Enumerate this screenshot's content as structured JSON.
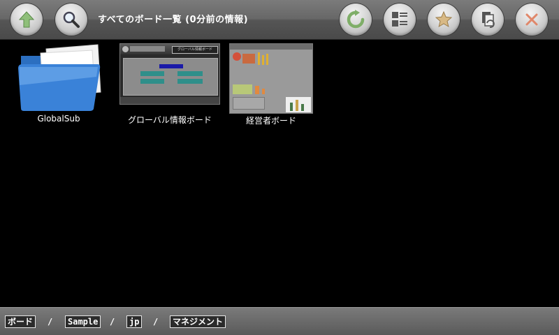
{
  "toolbar": {
    "title": "すべてのボード一覧 (0分前の情報)",
    "buttons": {
      "up": "up-arrow-icon",
      "search": "magnifier-icon",
      "refresh": "refresh-icon",
      "view": "view-mode-icon",
      "favorite": "star-icon",
      "copy": "copy-icon",
      "close": "close-icon"
    }
  },
  "items": [
    {
      "label": "GlobalSub",
      "kind": "folder"
    },
    {
      "label": "グローバル情報ボード",
      "kind": "board",
      "thumbnail_text": "グローバル情報ボード"
    },
    {
      "label": "経営者ボード",
      "kind": "board"
    }
  ],
  "breadcrumb": {
    "items": [
      "ボード",
      "Sample",
      "jp",
      "マネジメント"
    ],
    "separator": "/"
  },
  "colors": {
    "background": "#000000",
    "folder_blue": "#3a82d8",
    "teal_button": "#2f8f8a"
  }
}
